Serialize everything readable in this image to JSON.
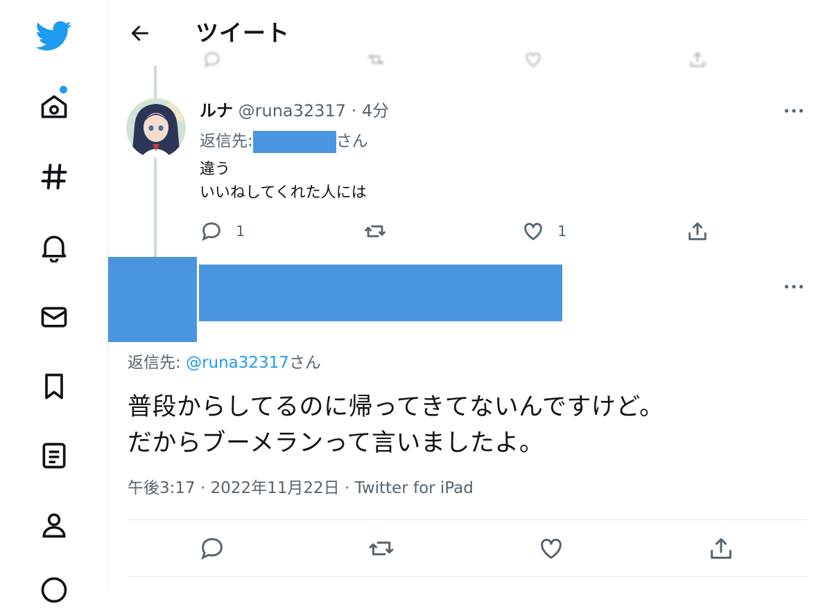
{
  "header": {
    "title": "ツイート"
  },
  "sidebar": {
    "items": [
      "twitter-logo",
      "home",
      "explore",
      "notifications",
      "messages",
      "bookmarks",
      "lists",
      "profile",
      "more"
    ]
  },
  "reply_tweet": {
    "name": "ルナ",
    "handle_meta": "@runa32317 · 4分",
    "reply_to_prefix": "返信先:",
    "reply_to_suffix": "さん",
    "body_line1": "違う",
    "body_line2": "いいねしてくれた人には",
    "reply_count": "1",
    "like_count": "1"
  },
  "main_tweet": {
    "reply_to_prefix": "返信先: ",
    "reply_to_handle": "@runa32317",
    "reply_to_suffix": "さん",
    "text_line1": "普段からしてるのに帰ってきてないんですけど。",
    "text_line2": "だからブーメランって言いましたよ。",
    "timestamp": "午後3:17 · 2022年11月22日 · Twitter for iPad"
  },
  "colors": {
    "accent": "#1d9bf0",
    "redaction": "#4a95e0",
    "secondary_text": "#536471"
  }
}
